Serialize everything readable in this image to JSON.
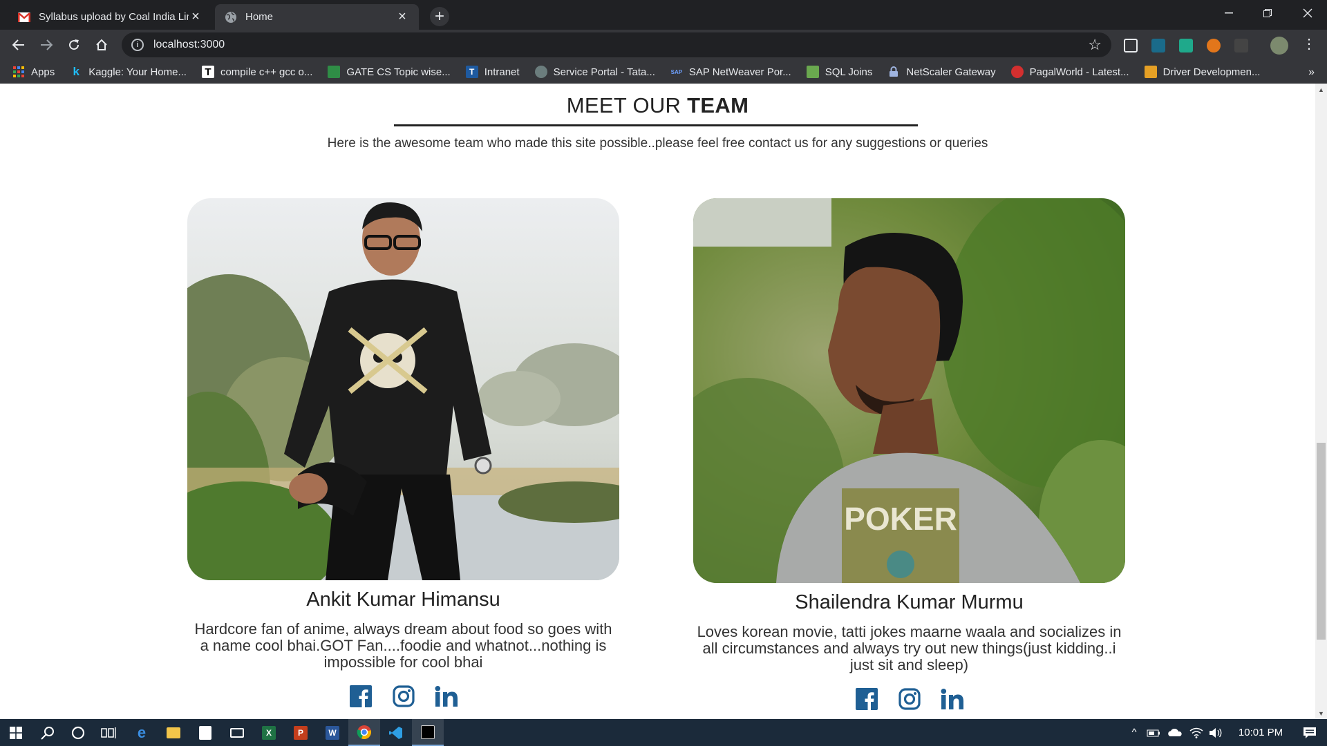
{
  "browser": {
    "tabs": [
      {
        "title": "Syllabus upload by Coal India Lin",
        "favicon": "gmail-icon",
        "active": false
      },
      {
        "title": "Home",
        "favicon": "globe-icon",
        "active": true
      }
    ],
    "new_tab": "+",
    "url": "localhost:3000",
    "bookmarks": [
      {
        "label": "Apps",
        "icon": "apps-grid-icon",
        "color": "#e8eaed"
      },
      {
        "label": "Kaggle: Your Home...",
        "icon": "kaggle-icon",
        "color": "#20beff",
        "glyph": "k"
      },
      {
        "label": "compile c++ gcc o...",
        "icon": "t-icon",
        "color": "#ffffff",
        "glyph": "T"
      },
      {
        "label": "GATE CS Topic wise...",
        "icon": "geeks-icon",
        "color": "#2f8d46",
        "glyph": ""
      },
      {
        "label": "Intranet",
        "icon": "tata-icon",
        "color": "#1e5aa0",
        "glyph": "T"
      },
      {
        "label": "Service Portal - Tata...",
        "icon": "portal-icon",
        "color": "#6b7d7d",
        "glyph": ""
      },
      {
        "label": "SAP NetWeaver Por...",
        "icon": "sap-icon",
        "color": "#2a62b3",
        "glyph": "SAP"
      },
      {
        "label": "SQL Joins",
        "icon": "sql-icon",
        "color": "#6aa84f",
        "glyph": ""
      },
      {
        "label": "NetScaler Gateway",
        "icon": "lock-icon",
        "color": "#6d8cc7",
        "glyph": ""
      },
      {
        "label": "PagalWorld - Latest...",
        "icon": "pagalworld-icon",
        "color": "#d32f2f",
        "glyph": ""
      },
      {
        "label": "Driver Developmen...",
        "icon": "driver-icon",
        "color": "#e5a025",
        "glyph": ""
      }
    ],
    "bookmarks_more": "»"
  },
  "page": {
    "heading_light": "MEET OUR ",
    "heading_bold": "TEAM",
    "subtitle": "Here is the awesome team who made this site possible..please feel free contact us for any suggestions or queries",
    "members": [
      {
        "name": "Ankit Kumar Himansu",
        "bio": "Hardcore fan of anime, always dream about food so goes with a name cool bhai.GOT Fan....foodie and whatnot...nothing is impossible for cool bhai"
      },
      {
        "name": "Shailendra Kumar Murmu",
        "bio": "Loves korean movie, tatti jokes maarne waala and socializes in all circumstances and always try out new things(just kidding..i just sit and sleep)"
      }
    ],
    "social_color": "#1f5f94"
  },
  "taskbar": {
    "time": "10:01 PM"
  }
}
